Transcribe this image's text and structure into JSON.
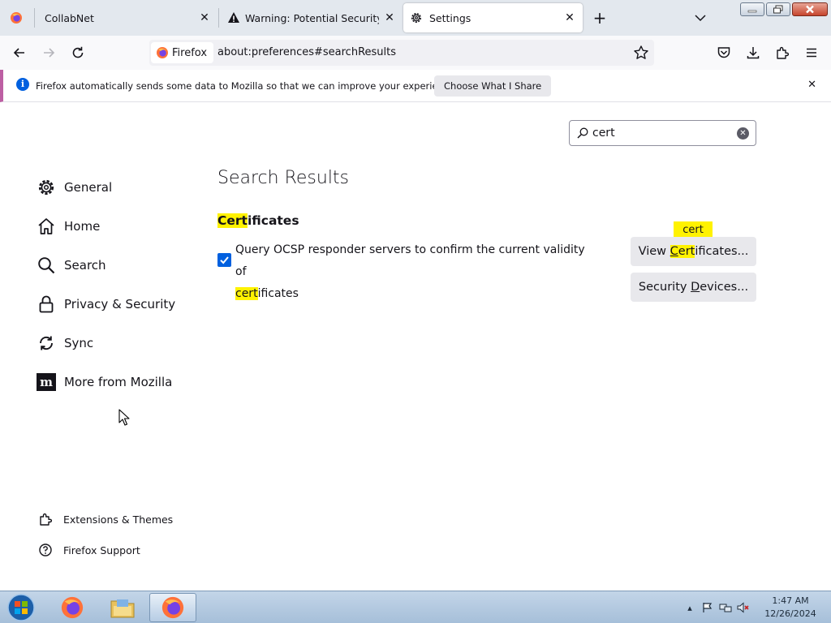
{
  "tabs": [
    {
      "label": "CollabNet",
      "icon": "firefox-icon",
      "active": false
    },
    {
      "label": "Warning: Potential Security Risk Ahead",
      "icon": "warning-icon",
      "active": false
    },
    {
      "label": "Settings",
      "icon": "gear-icon",
      "active": true
    }
  ],
  "navbar": {
    "identity_label": "Firefox",
    "url": "about:preferences#searchResults"
  },
  "notification": {
    "message": "Firefox automatically sends some data to Mozilla so that we can improve your experience.",
    "button": "Choose What I Share"
  },
  "search": {
    "value": "cert"
  },
  "sidebar": {
    "items": [
      {
        "label": "General",
        "icon": "gear-icon"
      },
      {
        "label": "Home",
        "icon": "home-icon"
      },
      {
        "label": "Search",
        "icon": "search-icon"
      },
      {
        "label": "Privacy & Security",
        "icon": "lock-icon"
      },
      {
        "label": "Sync",
        "icon": "sync-icon"
      },
      {
        "label": "More from Mozilla",
        "icon": "mozilla-icon"
      }
    ],
    "footer": [
      {
        "label": "Extensions & Themes",
        "icon": "puzzle-icon"
      },
      {
        "label": "Firefox Support",
        "icon": "help-icon"
      }
    ]
  },
  "main": {
    "title": "Search Results",
    "section": {
      "highlight": "Cert",
      "rest": "ificates"
    },
    "checkbox": {
      "checked": true,
      "label_before": "Query OCSP responder servers to confirm the current validity of",
      "label_highlight": "cert",
      "label_after": "ificates"
    },
    "view_button": {
      "prefix": "View ",
      "highlight_ak": "C",
      "highlight": "ert",
      "suffix": "ificates..."
    },
    "security_button": {
      "prefix": "Security ",
      "accesskey": "D",
      "suffix": "evices..."
    },
    "tooltip": "cert"
  },
  "taskbar": {
    "time": "1:47 AM",
    "date": "12/26/2024"
  },
  "colors": {
    "accent": "#0060df",
    "highlight": "#fff200",
    "notice_border": "#bd5fa3"
  }
}
